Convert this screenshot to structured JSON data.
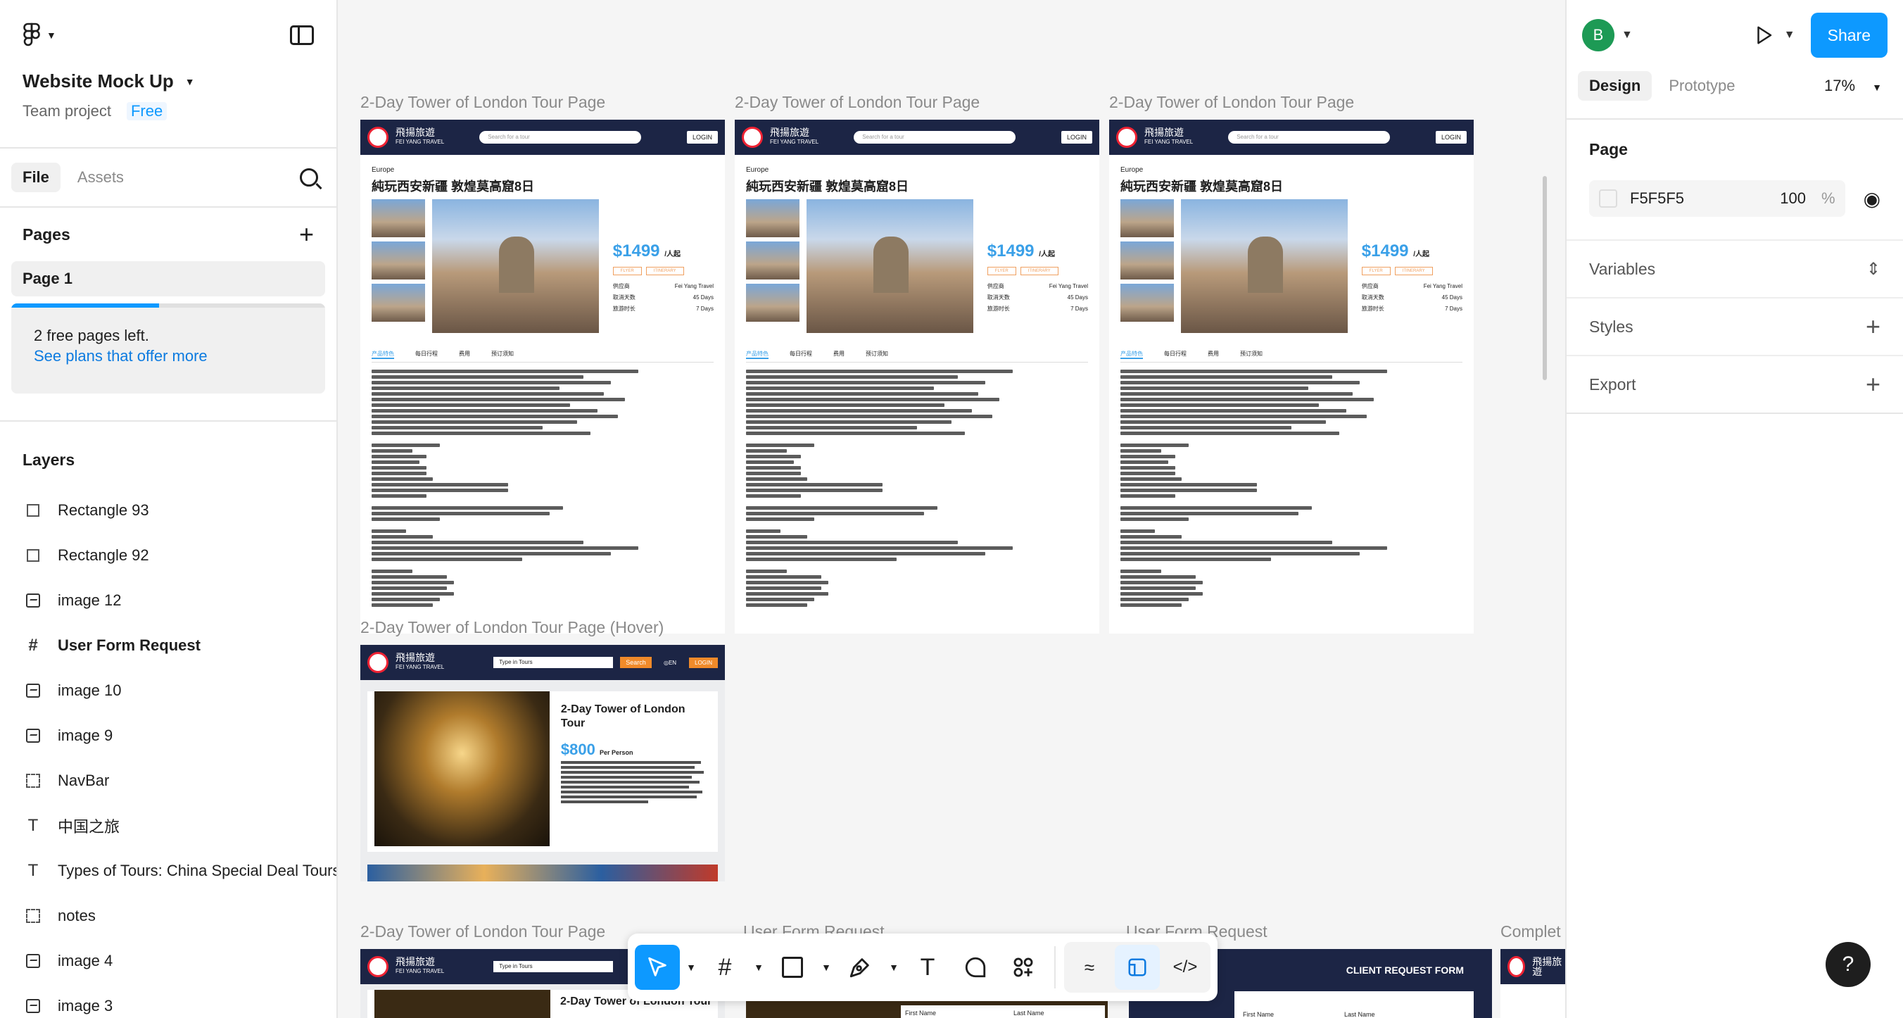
{
  "left": {
    "project_title": "Website Mock Up",
    "team": "Team project",
    "plan": "Free",
    "tabs": [
      "File",
      "Assets"
    ],
    "pages_heading": "Pages",
    "pages": [
      "Page 1"
    ],
    "free_pages_text": "2 free pages left.",
    "free_pages_link": "See plans that offer more",
    "layers_heading": "Layers",
    "layers": [
      {
        "name": "Rectangle 93",
        "icon": "rectangle-icon"
      },
      {
        "name": "Rectangle 92",
        "icon": "rectangle-icon"
      },
      {
        "name": "image 12",
        "icon": "image-icon"
      },
      {
        "name": "User Form Request",
        "icon": "frame-icon"
      },
      {
        "name": "image 10",
        "icon": "image-icon"
      },
      {
        "name": "image 9",
        "icon": "image-icon"
      },
      {
        "name": "NavBar",
        "icon": "group-icon"
      },
      {
        "name": "中国之旅",
        "icon": "text-icon"
      },
      {
        "name": "Types of Tours: China Special Deal Tours",
        "icon": "text-icon"
      },
      {
        "name": "notes",
        "icon": "group-icon"
      },
      {
        "name": "image 4",
        "icon": "image-icon"
      },
      {
        "name": "image 3",
        "icon": "image-icon"
      }
    ]
  },
  "right": {
    "avatar_letter": "B",
    "share_label": "Share",
    "tabs": [
      "Design",
      "Prototype"
    ],
    "zoom": "17%",
    "page_heading": "Page",
    "page_color": "F5F5F5",
    "page_opacity": "100",
    "percent": "%",
    "sections": [
      "Variables",
      "Styles",
      "Export"
    ],
    "help": "?"
  },
  "canvas": {
    "frame_label": "2-Day Tower of London Tour Page",
    "hover_label": "2-Day Tower of London Tour Page (Hover)",
    "user_form_label": "User Form Request",
    "complete_label": "Complet",
    "brand": "飛揚旅遊",
    "brand_sub": "FEI YANG TRAVEL",
    "search_placeholder": "Search for a tour",
    "login": "LOGIN",
    "category": "Europe",
    "tour_title": "純玩西安新疆 敦煌莫高窟8日",
    "price": "$1499",
    "price_unit": "/人起",
    "flyer": "FLYER",
    "itinerary": "ITINERARY",
    "info": [
      "供应商",
      "Fei Yang Travel",
      "取消天数",
      "45 Days",
      "旅游时长",
      "7 Days"
    ],
    "tabs": [
      "产品特色",
      "每日行程",
      "费用",
      "预订须知"
    ],
    "hover_search": "Type in Tours",
    "hover_search_btn": "Search",
    "hover_lang": "EN",
    "hover_title": "2-Day Tower of London Tour",
    "hover_price": "$800",
    "hover_price_unit": "Per Person",
    "client_form": "CLIENT REQUEST FORM",
    "first_name": "First Name",
    "last_name": "Last Name"
  },
  "toolbar": {
    "tools": [
      "move-tool",
      "frame-tool",
      "rectangle-tool",
      "pen-tool",
      "text-tool",
      "comment-tool",
      "actions-tool"
    ],
    "modes": [
      "draw-mode",
      "design-mode",
      "dev-mode"
    ]
  }
}
